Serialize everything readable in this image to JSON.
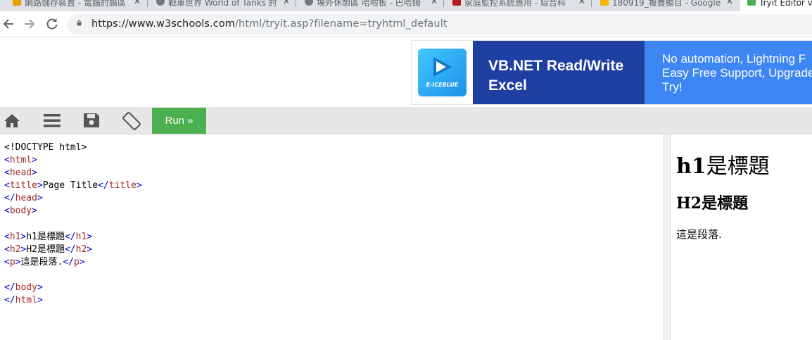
{
  "browser": {
    "tabs": [
      {
        "label": "網路儲存裝置 - 電腦討論區",
        "favicon_color": "#e8a000"
      },
      {
        "label": "戰車世界 World of Tanks 討",
        "favicon_color": "#777777"
      },
      {
        "label": "場外休憩區 哈啦板 - 巴哈姆",
        "favicon_color": "#777777"
      },
      {
        "label": "家庭監控系統應用 - 綜合科",
        "favicon_color": "#b71c1c"
      },
      {
        "label": "180919_複賽顯目 - Google",
        "favicon_color": "#f4b400"
      },
      {
        "label": "Tryit Editor v",
        "favicon_color": "#4caf50"
      }
    ],
    "url_domain": "https://www.w3schools.com",
    "url_path": "/html/tryit.asp?filename=tryhtml_default"
  },
  "ad": {
    "brand": "E-ICEBLUE",
    "headline": "VB.NET Read/Write Excel",
    "tagline_lines": [
      "No automation, Lightning F",
      "Easy Free Support, Upgrade",
      "Try!"
    ],
    "colors": {
      "mid": "#1f3fa3",
      "right": "#3f86f5"
    }
  },
  "toolbar": {
    "run_label": "Run »",
    "icons": [
      "home-icon",
      "menu-icon",
      "save-icon",
      "rotate-icon"
    ],
    "accent": "#4caf50"
  },
  "code_lines": [
    [
      {
        "t": "plain",
        "v": "<!DOCTYPE html>"
      }
    ],
    [
      {
        "t": "br",
        "v": "<"
      },
      {
        "t": "tag",
        "v": "html"
      },
      {
        "t": "br",
        "v": ">"
      }
    ],
    [
      {
        "t": "br",
        "v": "<"
      },
      {
        "t": "tag",
        "v": "head"
      },
      {
        "t": "br",
        "v": ">"
      }
    ],
    [
      {
        "t": "br",
        "v": "<"
      },
      {
        "t": "tag",
        "v": "title"
      },
      {
        "t": "br",
        "v": ">"
      },
      {
        "t": "plain",
        "v": "Page Title"
      },
      {
        "t": "br",
        "v": "</"
      },
      {
        "t": "tag",
        "v": "title"
      },
      {
        "t": "br",
        "v": ">"
      }
    ],
    [
      {
        "t": "br",
        "v": "</"
      },
      {
        "t": "tag",
        "v": "head"
      },
      {
        "t": "br",
        "v": ">"
      }
    ],
    [
      {
        "t": "br",
        "v": "<"
      },
      {
        "t": "tag",
        "v": "body"
      },
      {
        "t": "br",
        "v": ">"
      }
    ],
    [],
    [
      {
        "t": "br",
        "v": "<"
      },
      {
        "t": "tag",
        "v": "h1"
      },
      {
        "t": "br",
        "v": ">"
      },
      {
        "t": "plain",
        "v": "h1是標題"
      },
      {
        "t": "br",
        "v": "</"
      },
      {
        "t": "tag",
        "v": "h1"
      },
      {
        "t": "br",
        "v": ">"
      }
    ],
    [
      {
        "t": "br",
        "v": "<"
      },
      {
        "t": "tag",
        "v": "h2"
      },
      {
        "t": "br",
        "v": ">"
      },
      {
        "t": "plain",
        "v": "H2是標題"
      },
      {
        "t": "br",
        "v": "</"
      },
      {
        "t": "tag",
        "v": "h2"
      },
      {
        "t": "br",
        "v": ">"
      }
    ],
    [
      {
        "t": "br",
        "v": "<"
      },
      {
        "t": "tag",
        "v": "p"
      },
      {
        "t": "br",
        "v": ">"
      },
      {
        "t": "plain",
        "v": "這是段落."
      },
      {
        "t": "br",
        "v": "</"
      },
      {
        "t": "tag",
        "v": "p"
      },
      {
        "t": "br",
        "v": ">"
      }
    ],
    [],
    [
      {
        "t": "br",
        "v": "</"
      },
      {
        "t": "tag",
        "v": "body"
      },
      {
        "t": "br",
        "v": ">"
      }
    ],
    [
      {
        "t": "br",
        "v": "</"
      },
      {
        "t": "tag",
        "v": "html"
      },
      {
        "t": "br",
        "v": ">"
      }
    ]
  ],
  "result": {
    "h1_latin": "h1",
    "h1_cjk": "是標題",
    "h2": "H2是標題",
    "p": "這是段落."
  }
}
